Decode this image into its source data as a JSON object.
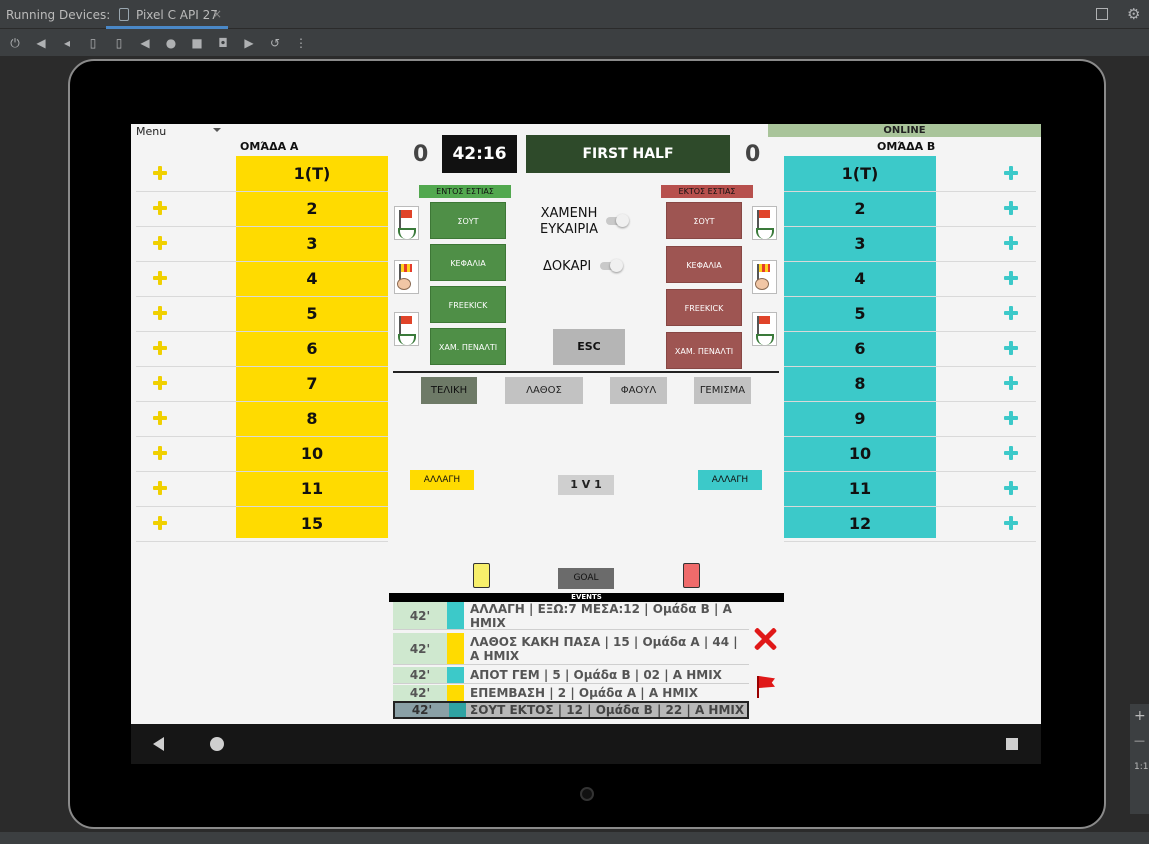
{
  "ide": {
    "title": "Running Devices:",
    "tab_label": "Pixel C API 27",
    "tab_close": "×",
    "right_strip": [
      "+",
      "—",
      "1:1"
    ]
  },
  "app": {
    "menu_label": "Menu",
    "online_label": "ONLINE",
    "team_a": {
      "name": "ΟΜΆΔΑ Α",
      "score": "0",
      "color": "#ffdb00",
      "players": [
        "1(T)",
        "2",
        "3",
        "4",
        "5",
        "6",
        "7",
        "8",
        "10",
        "11",
        "15"
      ]
    },
    "team_b": {
      "name": "ΟΜΆΔΑ Β",
      "score": "0",
      "color": "#3cc9c9",
      "players": [
        "1(T)",
        "2",
        "3",
        "4",
        "5",
        "6",
        "8",
        "9",
        "10",
        "11",
        "12"
      ]
    },
    "clock": "42:16",
    "period": "FIRST HALF",
    "on_target": {
      "header": "ΕΝΤΟΣ ΕΣΤΙΑΣ",
      "buttons": [
        "ΣΟΥΤ",
        "ΚΕΦΑΛΙΑ",
        "FREEKICK",
        "ΧΑΜ. ΠΕΝΑΛΤΙ"
      ]
    },
    "off_target": {
      "header": "ΕΚΤΟΣ ΕΣΤΙΑΣ",
      "buttons": [
        "ΣΟΥΤ",
        "ΚΕΦΑΛΙΑ",
        "FREEKICK",
        "ΧΑΜ. ΠΕΝΑΛΤΙ"
      ]
    },
    "toggles": {
      "missed_chance_line1": "ΧΑΜΕΝΗ",
      "missed_chance_line2": "ΕΥΚΑΙΡΙΑ",
      "post": "ΔΟΚΑΡΙ"
    },
    "esc": "ESC",
    "actions": [
      "ΤΕΛΙΚΗ",
      "ΛΑΘΟΣ",
      "ΦΑΟΥΛ",
      "ΓΕΜΙΣΜΑ"
    ],
    "sub_label": "ΑΛΛΑΓΗ",
    "one_v_one": "1 V 1",
    "goal": "GOAL",
    "events_header": "EVENTS",
    "events": [
      {
        "minute": "42'",
        "team_color": "#3cc9c9",
        "text": "ΑΛΛΑΓΗ | ΕΞΩ:7 ΜΕΣΑ:12 | Ομάδα Β | Α ΗΜΙΧ"
      },
      {
        "minute": "42'",
        "team_color": "#ffdb00",
        "text": "ΛΑΘΟΣ ΚΑΚΗ ΠΑΣΑ | 15 | Ομάδα Α | 44 | Α ΗΜΙΧ"
      },
      {
        "minute": "42'",
        "team_color": "#3cc9c9",
        "text": "ΑΠΟΤ ΓΕΜ | 5 | Ομάδα Β | 02 | Α ΗΜΙΧ"
      },
      {
        "minute": "42'",
        "team_color": "#ffdb00",
        "text": "ΕΠΕΜΒΑΣΗ | 2 | Ομάδα Α | Α ΗΜΙΧ"
      },
      {
        "minute": "42'",
        "team_color": "#2fa3a3",
        "text": "ΣΟΥΤ ΕΚΤΟΣ | 12 | Ομάδα Β | 22 | Α ΗΜΙΧ"
      }
    ]
  }
}
